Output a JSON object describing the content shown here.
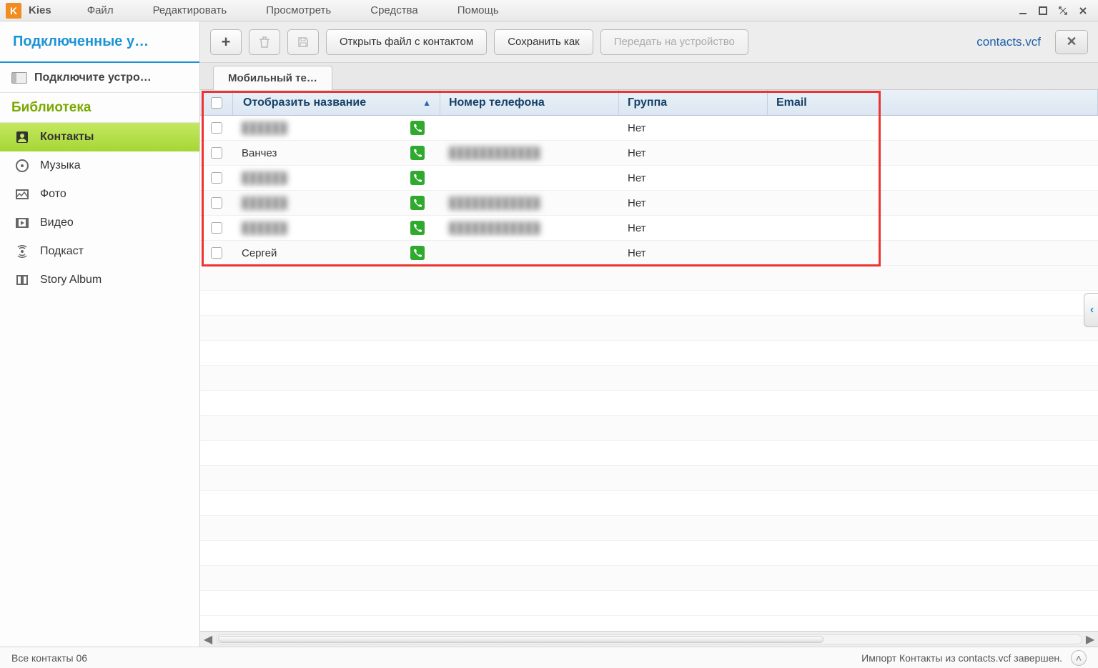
{
  "menubar": {
    "app_name": "Kies",
    "items": [
      "Файл",
      "Редактировать",
      "Просмотреть",
      "Средства",
      "Помощь"
    ]
  },
  "sidebar": {
    "header": "Подключенные у…",
    "device": "Подключите устро…",
    "library_label": "Библиотека",
    "items": [
      {
        "label": "Контакты",
        "icon": "contact-icon",
        "active": true
      },
      {
        "label": "Музыка",
        "icon": "music-icon",
        "active": false
      },
      {
        "label": "Фото",
        "icon": "photo-icon",
        "active": false
      },
      {
        "label": "Видео",
        "icon": "video-icon",
        "active": false
      },
      {
        "label": "Подкаст",
        "icon": "podcast-icon",
        "active": false
      },
      {
        "label": "Story Album",
        "icon": "story-album-icon",
        "active": false
      }
    ]
  },
  "toolbar": {
    "add_label": "+",
    "open_label": "Открыть файл с контактом",
    "save_as_label": "Сохранить как",
    "transfer_label": "Передать на устройство",
    "filename": "contacts.vcf",
    "close_label": "✕"
  },
  "tabs": {
    "items": [
      {
        "label": "Мобильный те…",
        "active": true
      }
    ]
  },
  "table": {
    "columns": {
      "display_name": "Отобразить название",
      "phone": "Номер телефона",
      "group": "Группа",
      "email": "Email"
    },
    "rows": [
      {
        "name": "",
        "name_blurred": true,
        "phone": "",
        "phone_blurred": false,
        "group": "Нет",
        "email": ""
      },
      {
        "name": "Ванчез",
        "name_blurred": false,
        "phone": "",
        "phone_blurred": true,
        "group": "Нет",
        "email": ""
      },
      {
        "name": "",
        "name_blurred": true,
        "phone": "",
        "phone_blurred": false,
        "group": "Нет",
        "email": ""
      },
      {
        "name": "",
        "name_blurred": true,
        "phone": "",
        "phone_blurred": true,
        "group": "Нет",
        "email": ""
      },
      {
        "name": "",
        "name_blurred": true,
        "phone": "",
        "phone_blurred": true,
        "group": "Нет",
        "email": ""
      },
      {
        "name": "Сергей",
        "name_blurred": false,
        "phone": "",
        "phone_blurred": false,
        "group": "Нет",
        "email": ""
      }
    ]
  },
  "statusbar": {
    "left": "Все контакты 06",
    "right": "Импорт Контакты из contacts.vcf завершен."
  }
}
